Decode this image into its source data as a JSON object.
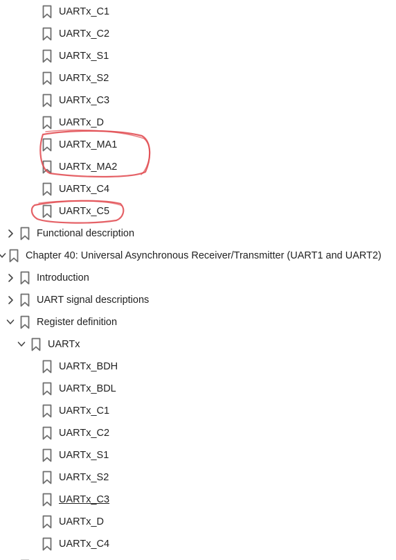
{
  "bookmarks": [
    {
      "label": "UARTx_C1",
      "level": 3,
      "chevron": "none"
    },
    {
      "label": "UARTx_C2",
      "level": 3,
      "chevron": "none"
    },
    {
      "label": "UARTx_S1",
      "level": 3,
      "chevron": "none"
    },
    {
      "label": "UARTx_S2",
      "level": 3,
      "chevron": "none"
    },
    {
      "label": "UARTx_C3",
      "level": 3,
      "chevron": "none"
    },
    {
      "label": "UARTx_D",
      "level": 3,
      "chevron": "none"
    },
    {
      "label": "UARTx_MA1",
      "level": 3,
      "chevron": "none"
    },
    {
      "label": "UARTx_MA2",
      "level": 3,
      "chevron": "none"
    },
    {
      "label": "UARTx_C4",
      "level": 3,
      "chevron": "none"
    },
    {
      "label": "UARTx_C5",
      "level": 3,
      "chevron": "none"
    },
    {
      "label": "Functional description",
      "level": 1,
      "chevron": "collapsed"
    },
    {
      "label": "Chapter 40: Universal Asynchronous Receiver/Transmitter (UART1 and UART2)",
      "level": 0,
      "chevron": "expanded"
    },
    {
      "label": "Introduction",
      "level": 1,
      "chevron": "collapsed"
    },
    {
      "label": "UART signal descriptions",
      "level": 1,
      "chevron": "collapsed"
    },
    {
      "label": "Register definition",
      "level": 1,
      "chevron": "expanded"
    },
    {
      "label": "UARTx",
      "level": 2,
      "chevron": "expanded"
    },
    {
      "label": "UARTx_BDH",
      "level": 3,
      "chevron": "none"
    },
    {
      "label": "UARTx_BDL",
      "level": 3,
      "chevron": "none"
    },
    {
      "label": "UARTx_C1",
      "level": 3,
      "chevron": "none"
    },
    {
      "label": "UARTx_C2",
      "level": 3,
      "chevron": "none"
    },
    {
      "label": "UARTx_S1",
      "level": 3,
      "chevron": "none"
    },
    {
      "label": "UARTx_S2",
      "level": 3,
      "chevron": "none"
    },
    {
      "label": "UARTx_C3",
      "level": 3,
      "chevron": "none",
      "hovered": true
    },
    {
      "label": "UARTx_D",
      "level": 3,
      "chevron": "none"
    },
    {
      "label": "UARTx_C4",
      "level": 3,
      "chevron": "none"
    },
    {
      "label": "",
      "level": 1,
      "chevron": "none",
      "partial": true
    }
  ],
  "annotations": [
    {
      "type": "freehand-ellipse",
      "color": "#e0474c",
      "encloses": [
        "UARTx_MA1",
        "UARTx_MA2"
      ]
    },
    {
      "type": "freehand-ellipse",
      "color": "#e0474c",
      "encloses": [
        "UARTx_C5"
      ]
    }
  ],
  "icons": {
    "bookmark": "bookmark-icon",
    "expanded": "chevron-down-icon",
    "collapsed": "chevron-right-icon"
  },
  "colors": {
    "icon": "#6e6e6e",
    "text": "#222222",
    "annotation": "#e0474c"
  }
}
